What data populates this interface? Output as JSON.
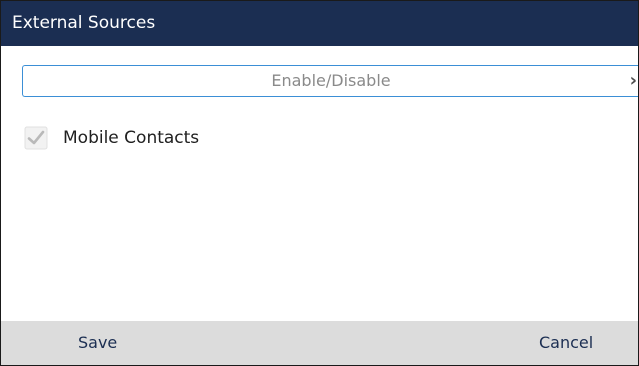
{
  "header": {
    "title": "External Sources"
  },
  "selector": {
    "label": "Enable/Disable",
    "icon": "chevron-right-icon"
  },
  "options": [
    {
      "label": "Mobile Contacts",
      "checked": true,
      "disabled": true
    }
  ],
  "softkeys": {
    "save": "Save",
    "cancel": "Cancel"
  },
  "colors": {
    "header_bg": "#1b2e52",
    "accent_border": "#3b8fd6",
    "footer_bg": "#dcdcdc"
  }
}
